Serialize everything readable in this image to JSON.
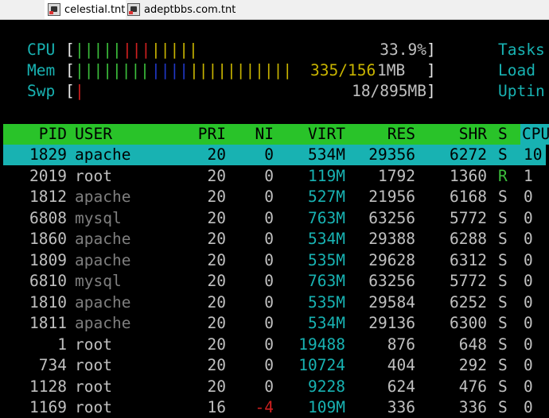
{
  "tabs": [
    {
      "label": "celestial.tnt",
      "icon": "terminal-session-icon",
      "active": true
    },
    {
      "label": "adeptbbs.com.tnt",
      "icon": "terminal-session-icon",
      "active": false
    }
  ],
  "meters": {
    "cpu": {
      "label": "CPU",
      "open": "[",
      "bar": [
        "|||||",
        "|||",
        "|||||"
      ],
      "value": "33.9%",
      "close": "]"
    },
    "mem": {
      "label": "Mem",
      "open": "[",
      "bar": [
        "||||||||",
        "||||",
        "|||||||||||"
      ],
      "value_a": "335/156",
      "value_b": "1MB",
      "close": "]"
    },
    "swp": {
      "label": "Swp",
      "open": "[",
      "bar": [
        "|"
      ],
      "value": "18/895MB",
      "close": "]"
    }
  },
  "right_panel": {
    "tasks": "Tasks",
    "load": "Load",
    "uptime": "Uptin"
  },
  "columns": [
    "PID",
    "USER",
    "PRI",
    "NI",
    "VIRT",
    "RES",
    "SHR",
    "S",
    "CPU"
  ],
  "processes": [
    {
      "pid": "1829",
      "user": "apache",
      "pri": "20",
      "ni": "0",
      "virt": "534M",
      "res": "29356",
      "shr": "6272",
      "s": "S",
      "cpu": "10",
      "selected": true
    },
    {
      "pid": "2019",
      "user": "root",
      "pri": "20",
      "ni": "0",
      "virt": "119M",
      "res": "1792",
      "shr": "1360",
      "s": "R",
      "cpu": "1"
    },
    {
      "pid": "1812",
      "user": "apache",
      "pri": "20",
      "ni": "0",
      "virt": "527M",
      "res": "21956",
      "shr": "6168",
      "s": "S",
      "cpu": "0"
    },
    {
      "pid": "6808",
      "user": "mysql",
      "pri": "20",
      "ni": "0",
      "virt": "763M",
      "res": "63256",
      "shr": "5772",
      "s": "S",
      "cpu": "0"
    },
    {
      "pid": "1860",
      "user": "apache",
      "pri": "20",
      "ni": "0",
      "virt": "534M",
      "res": "29388",
      "shr": "6288",
      "s": "S",
      "cpu": "0"
    },
    {
      "pid": "1809",
      "user": "apache",
      "pri": "20",
      "ni": "0",
      "virt": "535M",
      "res": "29628",
      "shr": "6312",
      "s": "S",
      "cpu": "0"
    },
    {
      "pid": "6810",
      "user": "mysql",
      "pri": "20",
      "ni": "0",
      "virt": "763M",
      "res": "63256",
      "shr": "5772",
      "s": "S",
      "cpu": "0"
    },
    {
      "pid": "1810",
      "user": "apache",
      "pri": "20",
      "ni": "0",
      "virt": "535M",
      "res": "29584",
      "shr": "6252",
      "s": "S",
      "cpu": "0"
    },
    {
      "pid": "1811",
      "user": "apache",
      "pri": "20",
      "ni": "0",
      "virt": "534M",
      "res": "29136",
      "shr": "6300",
      "s": "S",
      "cpu": "0"
    },
    {
      "pid": "1",
      "user": "root",
      "pri": "20",
      "ni": "0",
      "virt": "19488",
      "res": "876",
      "shr": "648",
      "s": "S",
      "cpu": "0"
    },
    {
      "pid": "734",
      "user": "root",
      "pri": "20",
      "ni": "0",
      "virt": "10724",
      "res": "404",
      "shr": "292",
      "s": "S",
      "cpu": "0"
    },
    {
      "pid": "1128",
      "user": "root",
      "pri": "20",
      "ni": "0",
      "virt": "9228",
      "res": "624",
      "shr": "476",
      "s": "S",
      "cpu": "0"
    },
    {
      "pid": "1169",
      "user": "root",
      "pri": "16",
      "ni": "-4",
      "virt": "109M",
      "res": "336",
      "shr": "336",
      "s": "S",
      "cpu": "0"
    }
  ],
  "colors": {
    "header_bg": "#29c329",
    "selection_bg": "#18b2b2",
    "meter_label": "#18b2b2"
  }
}
